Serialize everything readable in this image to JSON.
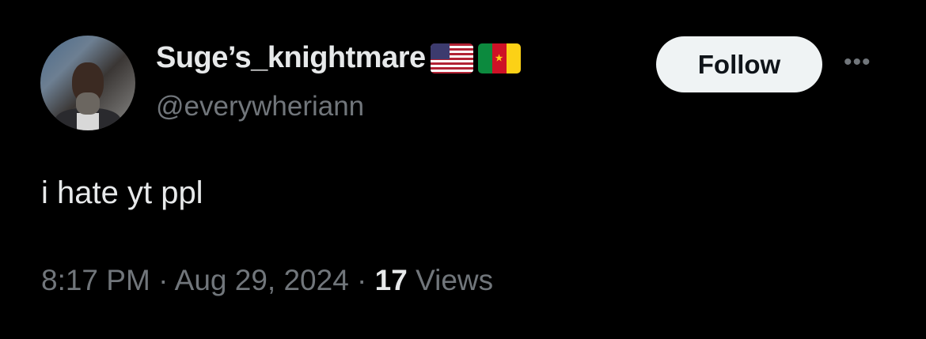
{
  "user": {
    "display_name": "Suge’s_knightmare",
    "handle": "@everywheriann",
    "flags": [
      "us-flag",
      "cameroon-flag"
    ]
  },
  "actions": {
    "follow_label": "Follow",
    "more_label": "•••"
  },
  "tweet": {
    "text": "i hate yt ppl",
    "time": "8:17 PM",
    "sep1": " · ",
    "date": "Aug 29, 2024",
    "sep2": " · ",
    "views_count": "17",
    "views_label": " Views"
  }
}
